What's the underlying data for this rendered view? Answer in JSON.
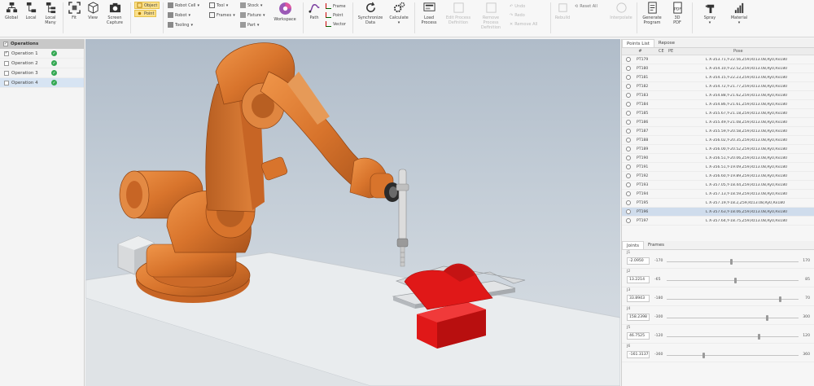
{
  "ribbon": {
    "global": "Global",
    "local": "Local",
    "local_many": "Local Many",
    "fit": "Fit",
    "view": "View",
    "screen_capture": "Screen Capture",
    "object": "Object",
    "point": "Point",
    "robot_cell": "Robot Cell",
    "robot": "Robot",
    "tooling": "Tooling",
    "tool": "Tool",
    "frames": "Frames",
    "stock": "Stock",
    "fixture": "Fixture",
    "part": "Part",
    "workspace": "Workspace",
    "path": "Path",
    "frame": "Frame",
    "point2": "Point",
    "vector": "Vector",
    "sync_data": "Synchronize Data",
    "calculate": "Calculate",
    "load_process": "Load Process",
    "edit_process": "Edit Process Definition",
    "remove_process": "Remove Process Definition",
    "undo": "Undo",
    "redo": "Redo",
    "remove_all": "Remove All",
    "reset_all": "Reset All",
    "rebuild": "Rebuild",
    "interpolate": "Interpolate",
    "generate_program": "Generate Program",
    "3d_pdf": "3D PDF",
    "spray": "Spray",
    "material": "Material"
  },
  "operations": {
    "header": "Operations",
    "items": [
      {
        "label": "Operation 1",
        "checked": true
      },
      {
        "label": "Operation 2",
        "checked": false
      },
      {
        "label": "Operation 3",
        "checked": false
      },
      {
        "label": "Operation 4",
        "checked": false
      }
    ]
  },
  "points": {
    "tabs": [
      "Points List",
      "Repose"
    ],
    "columns": {
      "num": "#",
      "ce": "CE",
      "pe": "PE",
      "pose": "Pose"
    },
    "rows": [
      {
        "name": "PT179",
        "pose": "L X-353.71,Y-22.56,Z59,Rz13.08,Ry0,Rx180"
      },
      {
        "name": "PT180",
        "pose": "L X-354.10,Y-22.52,Z59,Rz13.08,Ry0,Rx180"
      },
      {
        "name": "PT181",
        "pose": "L X-354.15,Y-22.23,Z59,Rz13.08,Ry0,Rx180"
      },
      {
        "name": "PT182",
        "pose": "L X-354.72,Y-21.77,Z59,Rz13.08,Ry0,Rx180"
      },
      {
        "name": "PT183",
        "pose": "L X-354.88,Y-21.62,Z59,Rz13.08,Ry0,Rx180"
      },
      {
        "name": "PT184",
        "pose": "L X-354.86,Y-21.61,Z59,Rz13.08,Ry0,Rx180"
      },
      {
        "name": "PT185",
        "pose": "L X-355.67,Y-21.18,Z59,Rz13.08,Ry0,Rx180"
      },
      {
        "name": "PT186",
        "pose": "L X-355.49,Y-21.08,Z59,Rz13.08,Ry0,Rx180"
      },
      {
        "name": "PT187",
        "pose": "L X-355.59,Y-20.58,Z59,Rz13.08,Ry0,Rx180"
      },
      {
        "name": "PT188",
        "pose": "L X-356.02,Y-20.35,Z59,Rz13.08,Ry0,Rx180"
      },
      {
        "name": "PT189",
        "pose": "L X-356.00,Y-20.52,Z59,Rz13.08,Ry0,Rx180"
      },
      {
        "name": "PT190",
        "pose": "L X-356.51,Y-20.06,Z59,Rz13.08,Ry0,Rx180"
      },
      {
        "name": "PT191",
        "pose": "L X-356.51,Y-19.09,Z59,Rz13.08,Ry0,Rx180"
      },
      {
        "name": "PT192",
        "pose": "L X-356.60,Y-19.89,Z59,Rz13.08,Ry0,Rx180"
      },
      {
        "name": "PT193",
        "pose": "L X-357.05,Y-18.44,Z59,Rz13.08,Ry0,Rx180"
      },
      {
        "name": "PT194",
        "pose": "L X-357.13,Y-18.59,Z59,Rz13.08,Ry0,Rx180"
      },
      {
        "name": "PT195",
        "pose": "L X-357.19,Y-18.2,Z59,Rz13.08,Ry0,Rx180"
      },
      {
        "name": "PT196",
        "pose": "L X-357.63,Y-18.06,Z59,Rz13.08,Ry0,Rx180"
      },
      {
        "name": "PT197",
        "pose": "L X-357.64,Y-18.75,Z59,Rz13.08,Ry0,Rx180"
      }
    ],
    "selected_index": 17
  },
  "joints": {
    "tabs": [
      "Joints",
      "Frames"
    ],
    "items": [
      {
        "label": "J1",
        "value": "-2.0950",
        "min": "-170",
        "max": "170",
        "fraction": 0.49
      },
      {
        "label": "J2",
        "value": "13.2214",
        "min": "-65",
        "max": "85",
        "fraction": 0.52
      },
      {
        "label": "J3",
        "value": "33.8943",
        "min": "-180",
        "max": "70",
        "fraction": 0.86
      },
      {
        "label": "J4",
        "value": "158.2398",
        "min": "-300",
        "max": "300",
        "fraction": 0.76
      },
      {
        "label": "J5",
        "value": "46.7525",
        "min": "-120",
        "max": "120",
        "fraction": 0.7
      },
      {
        "label": "J6",
        "value": "-161.3137",
        "min": "-360",
        "max": "360",
        "fraction": 0.28
      }
    ]
  },
  "colors": {
    "robot": "#d8742c",
    "workpiece": "#e01818",
    "ribbon_bg": "#f7f7f7",
    "selection": "#cfdcec",
    "ok_green": "#34a853"
  }
}
